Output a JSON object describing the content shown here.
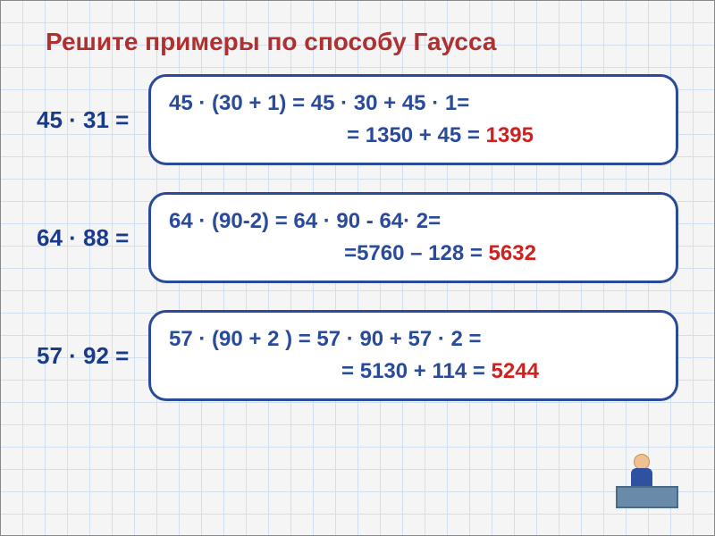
{
  "title": "Решите примеры по способу Гаусса",
  "examples": [
    {
      "problem": "45 · 31 =",
      "line1": "45 · (30 + 1) = 45 · 30 + 45 · 1=",
      "line2_prefix": "= 1350 +  45 = ",
      "answer": "1395"
    },
    {
      "problem": "64 · 88 =",
      "line1": "64 · (90-2) = 64 · 90 - 64· 2=",
      "line2_prefix": "=5760 – 128 = ",
      "answer": "5632"
    },
    {
      "problem": "57 · 92 =",
      "line1": "57 · (90  + 2 ) = 57 · 90 + 57 · 2 =",
      "line2_prefix": "= 5130 +  114 = ",
      "answer": "5244"
    }
  ]
}
